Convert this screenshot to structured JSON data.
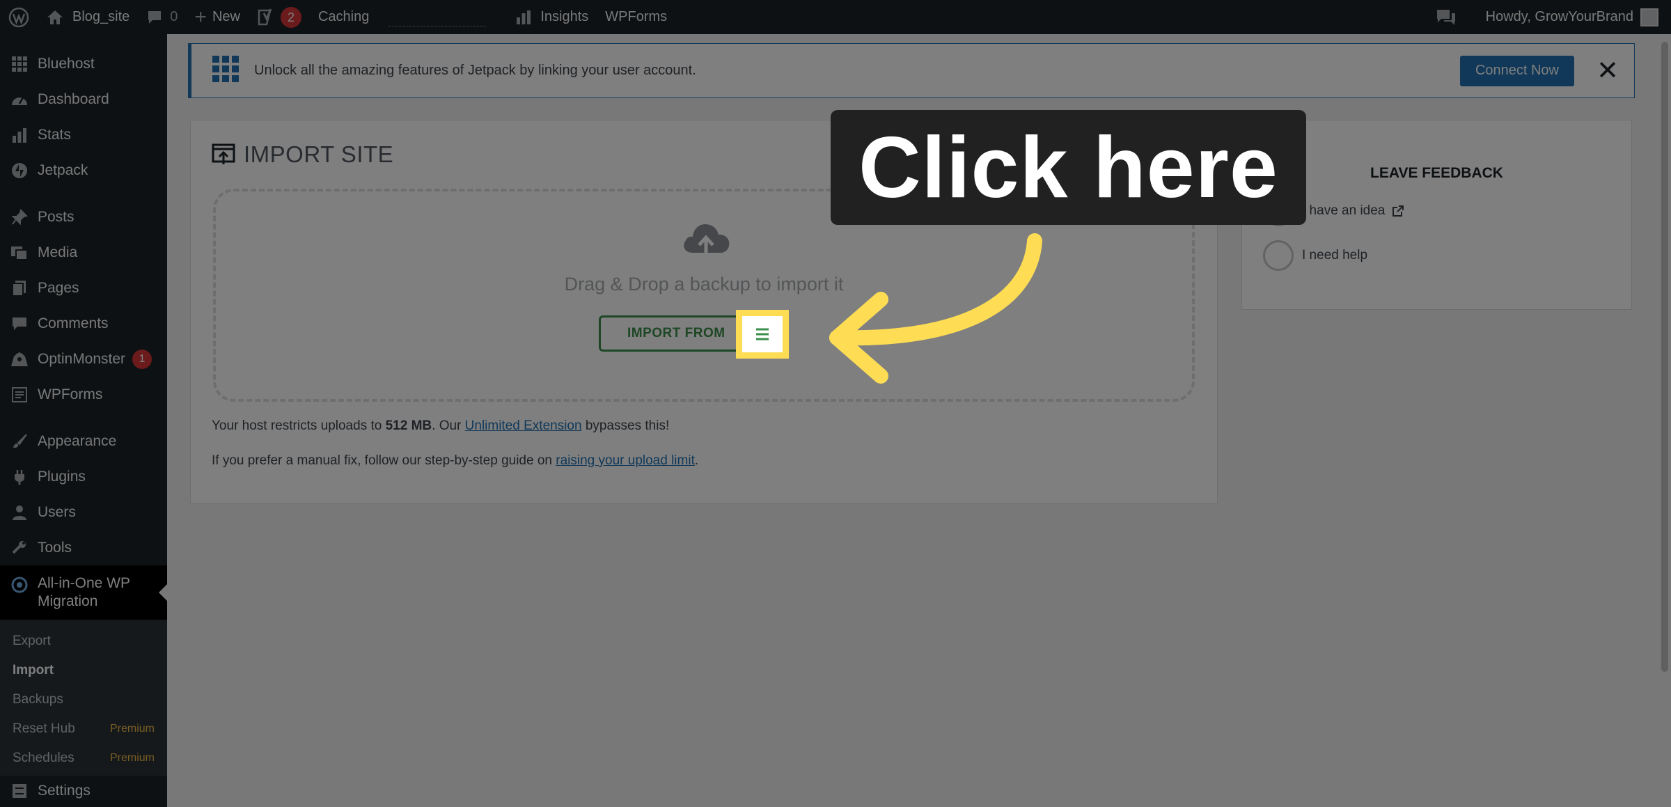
{
  "adminbar": {
    "site_name": "Blog_site",
    "comments_count": "0",
    "new_label": "New",
    "yoast_badge": "2",
    "caching_label": "Caching",
    "insights_label": "Insights",
    "wpforms_label": "WPForms",
    "howdy_label": "Howdy, GrowYourBrand"
  },
  "sidebar": {
    "items": [
      {
        "label": "Bluehost",
        "icon": "grid-icon"
      },
      {
        "label": "Dashboard",
        "icon": "dashboard-icon"
      },
      {
        "label": "Stats",
        "icon": "stats-icon"
      },
      {
        "label": "Jetpack",
        "icon": "jetpack-icon"
      },
      {
        "label": "Posts",
        "icon": "pin-icon"
      },
      {
        "label": "Media",
        "icon": "media-icon"
      },
      {
        "label": "Pages",
        "icon": "pages-icon"
      },
      {
        "label": "Comments",
        "icon": "comment-icon"
      },
      {
        "label": "OptinMonster",
        "icon": "monster-icon",
        "badge": "1"
      },
      {
        "label": "WPForms",
        "icon": "forms-icon"
      },
      {
        "label": "Appearance",
        "icon": "brush-icon"
      },
      {
        "label": "Plugins",
        "icon": "plugin-icon"
      },
      {
        "label": "Users",
        "icon": "user-icon"
      },
      {
        "label": "Tools",
        "icon": "wrench-icon"
      }
    ],
    "current": {
      "label": "All-in-One WP Migration",
      "icon": "migration-icon"
    },
    "submenu": [
      {
        "label": "Export"
      },
      {
        "label": "Import"
      },
      {
        "label": "Backups"
      },
      {
        "label": "Reset Hub",
        "tag": "Premium"
      },
      {
        "label": "Schedules",
        "tag": "Premium"
      }
    ],
    "settings_label": "Settings"
  },
  "notice": {
    "text": "Unlock all the amazing features of Jetpack by linking your user account.",
    "button": "Connect Now",
    "close": "✕"
  },
  "import": {
    "title": "IMPORT SITE",
    "drop_text": "Drag & Drop a backup to import it",
    "button": "IMPORT FROM",
    "limit_prefix": "Your host restricts uploads to ",
    "limit_value": "512 MB",
    "limit_mid": ". Our ",
    "limit_link": "Unlimited Extension",
    "limit_suffix": " bypasses this!",
    "manual_prefix": "If you prefer a manual fix, follow our step-by-step guide on ",
    "manual_link": "raising your upload limit",
    "manual_suffix": "."
  },
  "feedback": {
    "title": "LEAVE FEEDBACK",
    "options": [
      "I have an idea",
      "I need help"
    ]
  },
  "overlay": {
    "callout": "Click here",
    "accent": "#fedd55"
  }
}
